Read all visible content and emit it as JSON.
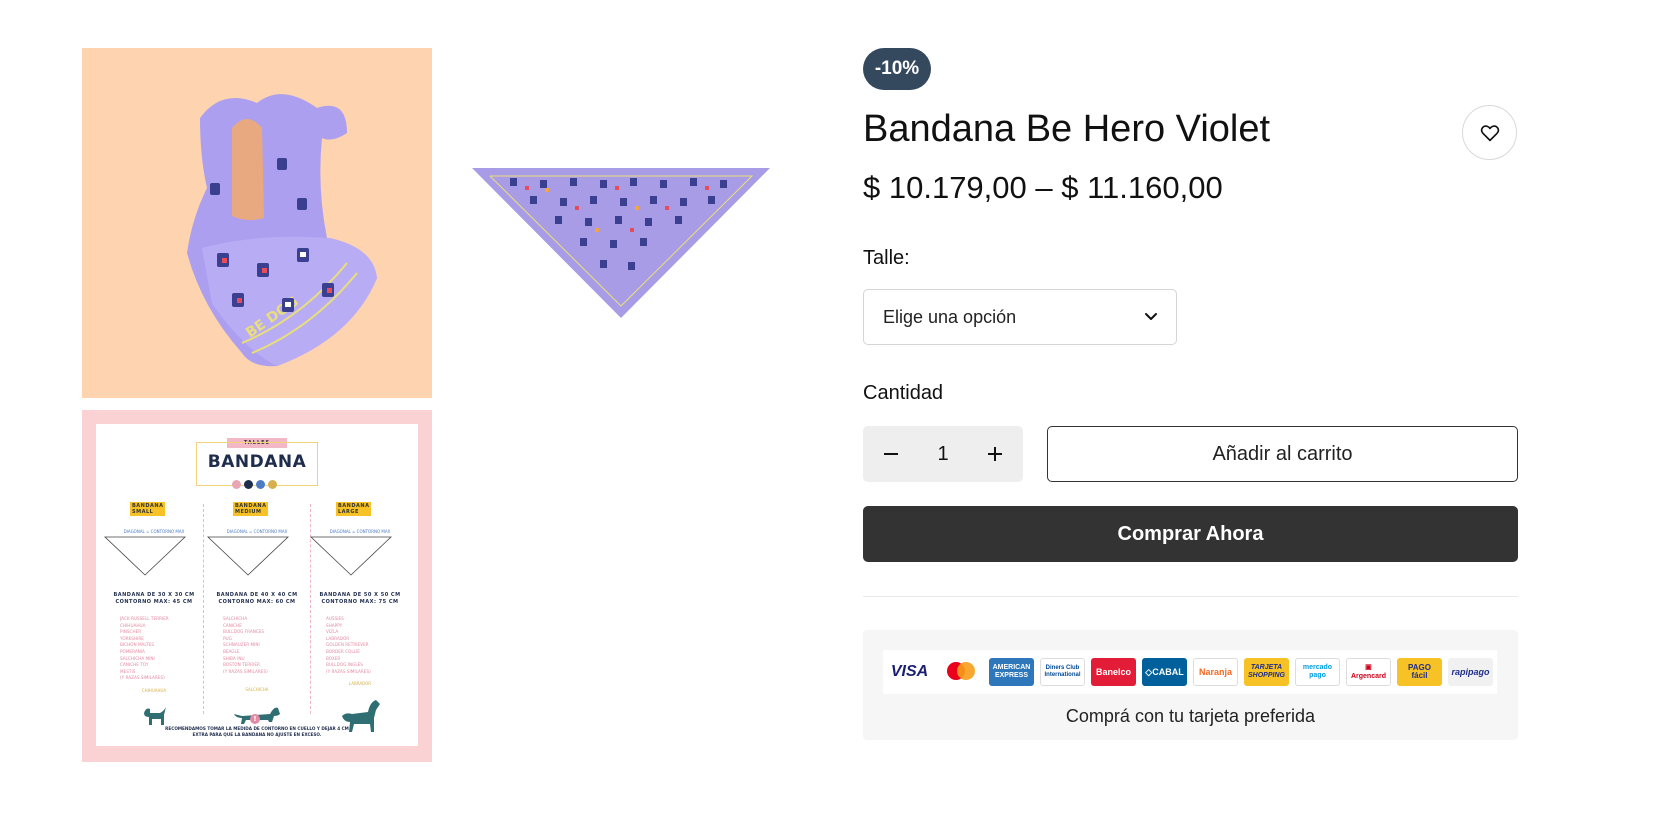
{
  "product": {
    "discount_badge": "-10%",
    "title": "Bandana Be Hero Violet",
    "price_range": "$ 10.179,00 – $ 11.160,00"
  },
  "size_selector": {
    "label": "Talle:",
    "selected": "Elige una opción"
  },
  "quantity": {
    "label": "Cantidad",
    "value": "1"
  },
  "actions": {
    "add_to_cart": "Añadir al carrito",
    "buy_now": "Comprar Ahora"
  },
  "payment": {
    "caption": "Comprá con tu tarjeta preferida",
    "cards": [
      {
        "name": "VISA",
        "icon": "visa-icon"
      },
      {
        "name": "mastercard",
        "icon": "mastercard-icon"
      },
      {
        "name": "AMERICAN EXPRESS",
        "icon": "amex-icon"
      },
      {
        "name": "Diners Club International",
        "icon": "diners-icon"
      },
      {
        "name": "Banelco",
        "icon": "banelco-icon"
      },
      {
        "name": "CABAL",
        "icon": "cabal-icon"
      },
      {
        "name": "Naranja",
        "icon": "naranja-icon"
      },
      {
        "name": "TARJETA SHOPPING",
        "icon": "shopping-icon"
      },
      {
        "name": "mercado pago",
        "icon": "mercadopago-icon"
      },
      {
        "name": "Argencard",
        "icon": "argencard-icon"
      },
      {
        "name": "PAGO fácil",
        "icon": "pagofacil-icon"
      },
      {
        "name": "rapipago",
        "icon": "rapipago-icon"
      }
    ]
  },
  "size_chart": {
    "tag": "TALLES",
    "title": "BANDANA",
    "dot_colors": [
      "#e8a6b4",
      "#1f2d4d",
      "#4b7bc4",
      "#d6b04a"
    ],
    "diagonal_label": "DIAGONAL = CONTORNO MAX",
    "columns": [
      {
        "tag_line1": "BANDANA",
        "tag_line2": "SMALL",
        "dim_line1": "BANDANA DE 30 X 30 CM",
        "dim_line2": "CONTORNO MAX: 45 CM",
        "breeds": [
          "JACK RUSSELL TERRIER",
          "CHIHUAHUA",
          "PINSCHER",
          "YORKSHIRE",
          "BICHON MALTES",
          "POMERANIA",
          "SALCHICHA MINI",
          "CANICHE TOY",
          "MESTIS",
          "(Y RAZAS SIMILARES)"
        ],
        "dog_label": "CHIHUAHUA"
      },
      {
        "tag_line1": "BANDANA",
        "tag_line2": "MEDIUM",
        "dim_line1": "BANDANA DE 40 X 40 CM",
        "dim_line2": "CONTORNO MAX: 60 CM",
        "breeds": [
          "SALCHICHA",
          "CANICHE",
          "BULLDOG FRANCES",
          "PUG",
          "SCHNAUZER MINI",
          "BEAGLE",
          "SHIBA INU",
          "BOSTON TERRIER",
          "(Y RAZAS SIMILARES)"
        ],
        "dog_label": "SALCHICHA"
      },
      {
        "tag_line1": "BANDANA",
        "tag_line2": "LARGE",
        "dim_line1": "BANDANA DE 50 X 50 CM",
        "dim_line2": "CONTORNO MAX: 75 CM",
        "breeds": [
          "AUSSIES",
          "SHAPPY",
          "VIZLA",
          "LABRADOR",
          "GOLDEN RETRIEVER",
          "BORDER COLLIE",
          "BOXER",
          "BULLDOG INGLES",
          "(Y RAZAS SIMILARES)"
        ],
        "dog_label": "LABRADOR"
      }
    ],
    "note_line1": "RECOMENDAMOS TOMAR LA MEDIDA DE CONTORNO EN CUELLO Y DEJAR 4 CM",
    "note_line2": "EXTRA PARA QUE LA BANDANA NO AJUSTE EN EXCESO."
  },
  "colors": {
    "badge_bg": "#35495e",
    "buy_now_bg": "#333333",
    "thumb1_bg": "#fed3b0",
    "thumb3_bg": "#fbd2d4",
    "bandana_violet": "#a99ce6"
  }
}
